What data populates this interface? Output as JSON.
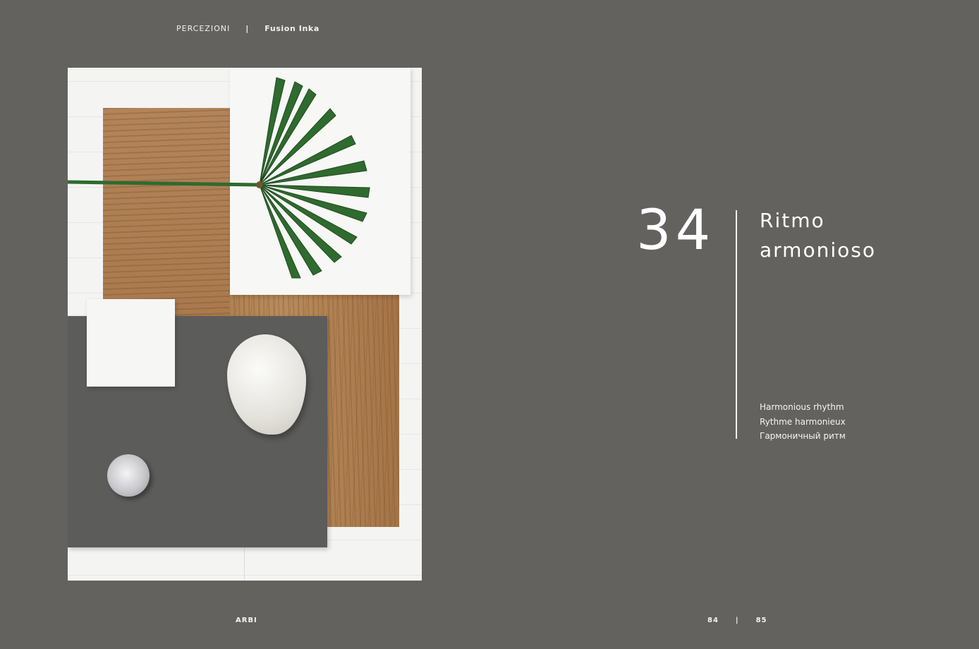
{
  "header": {
    "section": "PERCEZIONI",
    "separator": "|",
    "collection": "Fusion Inka"
  },
  "photo": {
    "subject": "material-moodboard"
  },
  "title_block": {
    "number": "34",
    "title_line1": "Ritmo",
    "title_line2": "armonioso",
    "translations": [
      "Harmonious rhythm",
      "Rythme harmonieux",
      "Гармоничный ритм"
    ]
  },
  "footer": {
    "brand": "ARBI",
    "page_left": "84",
    "separator": "|",
    "page_right": "85"
  },
  "colors": {
    "background": "#63625e",
    "text": "#ffffff",
    "leaf": "#2f6a2e",
    "wood": "#b0804f",
    "grey_panel": "#5c5c5b"
  }
}
